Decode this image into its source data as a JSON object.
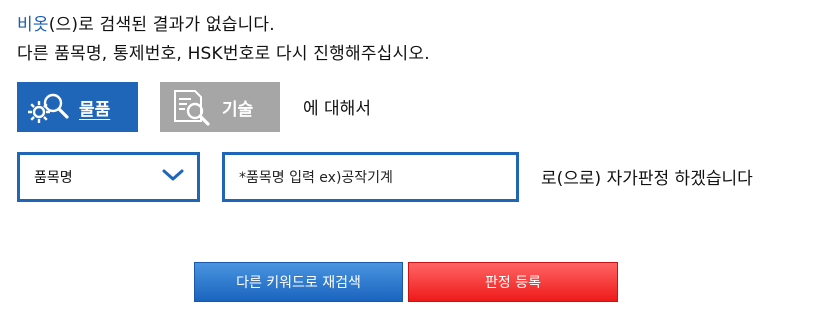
{
  "message": {
    "keyword": "비옷",
    "line1_suffix": "(으)로 검색된 결과가 없습니다.",
    "line2": "다른 품목명, 통제번호, HSK번호로 다시 진행해주십시오."
  },
  "type_buttons": {
    "goods_label": "물품",
    "tech_label": "기술",
    "about_text": "에 대해서"
  },
  "form": {
    "select_value": "품목명",
    "input_placeholder": "*품목명 입력 ex)공작기계",
    "suffix_text": "로(으로) 자가판정 하겠습니다"
  },
  "actions": {
    "research_label": "다른 키워드로 재검색",
    "register_label": "판정 등록"
  },
  "colors": {
    "accent_blue": "#1f66b8",
    "keyword_blue": "#1a5fb4",
    "inactive_gray": "#a6a6a6",
    "register_red": "#ee1a1a"
  }
}
